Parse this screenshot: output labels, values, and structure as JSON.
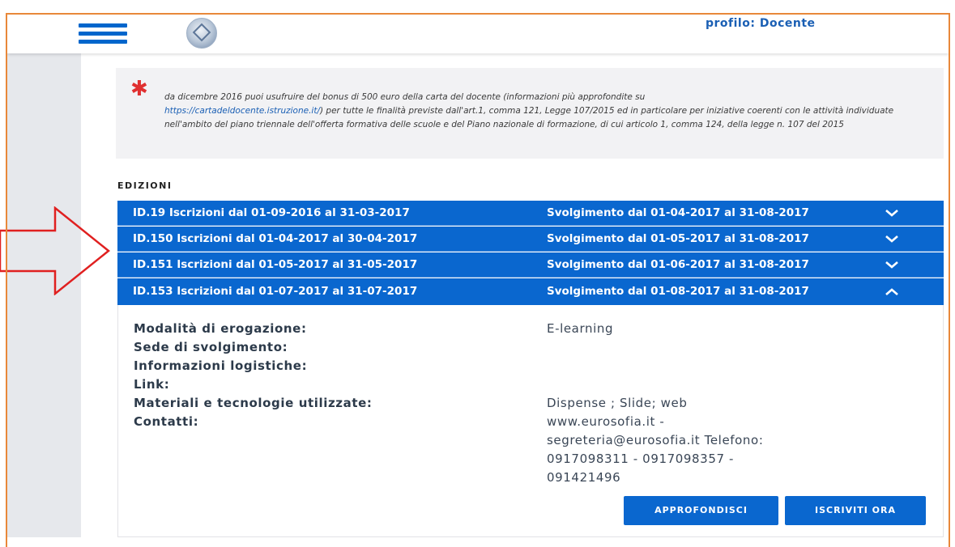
{
  "header": {
    "profile_label": "profilo: Docente",
    "menu_icon": "hamburger-menu-icon",
    "emblem_icon": "italian-republic-emblem"
  },
  "note": {
    "text_before_link": "da dicembre 2016 puoi usufruire del bonus di 500 euro della carta del docente (informazioni più approfondite su",
    "link": "https://cartadeldocente.istruzione.it/",
    "text_after_link": ") per tutte le finalità previste dall'art.1, comma 121, Legge 107/2015 ed in particolare per iniziative coerenti con le attività individuate nell'ambito del piano triennale dell'offerta formativa delle scuole e del Piano nazionale di formazione, di cui articolo 1, comma 124, della legge n. 107 del 2015"
  },
  "editions": {
    "title": "EDIZIONI",
    "rows": [
      {
        "left": "ID.19  Iscrizioni dal 01-09-2016 al 31-03-2017",
        "right": "Svolgimento dal 01-04-2017 al 31-08-2017",
        "expanded": false
      },
      {
        "left": "ID.150  Iscrizioni dal 01-04-2017 al 30-04-2017",
        "right": "Svolgimento dal 01-05-2017 al 31-08-2017",
        "expanded": false
      },
      {
        "left": "ID.151  Iscrizioni dal 01-05-2017 al 31-05-2017",
        "right": "Svolgimento dal 01-06-2017 al 31-08-2017",
        "expanded": false
      },
      {
        "left": "ID.153  Iscrizioni dal 01-07-2017 al 31-07-2017",
        "right": "Svolgimento dal 01-08-2017 al 31-08-2017",
        "expanded": true
      }
    ]
  },
  "details": {
    "labels": {
      "modalita": "Modalità di erogazione:",
      "sede": "Sede di svolgimento:",
      "info": "Informazioni logistiche:",
      "link": "Link:",
      "materiali": "Materiali e tecnologie utilizzate:",
      "contatti": "Contatti:"
    },
    "values": {
      "modalita": "E-learning",
      "materiali": "Dispense ; Slide; web",
      "contatti_lines": [
        "www.eurosofia.it -",
        "segreteria@eurosofia.it Telefono:",
        "0917098311 - 0917098357 -",
        "091421496"
      ]
    }
  },
  "buttons": {
    "approfondisci": "APPROFONDISCI",
    "iscriviti": "ISCRIVITI ORA"
  },
  "colors": {
    "accent": "#0a67cf",
    "annotation_arrow": "#e02020",
    "frame": "#e8883a"
  }
}
